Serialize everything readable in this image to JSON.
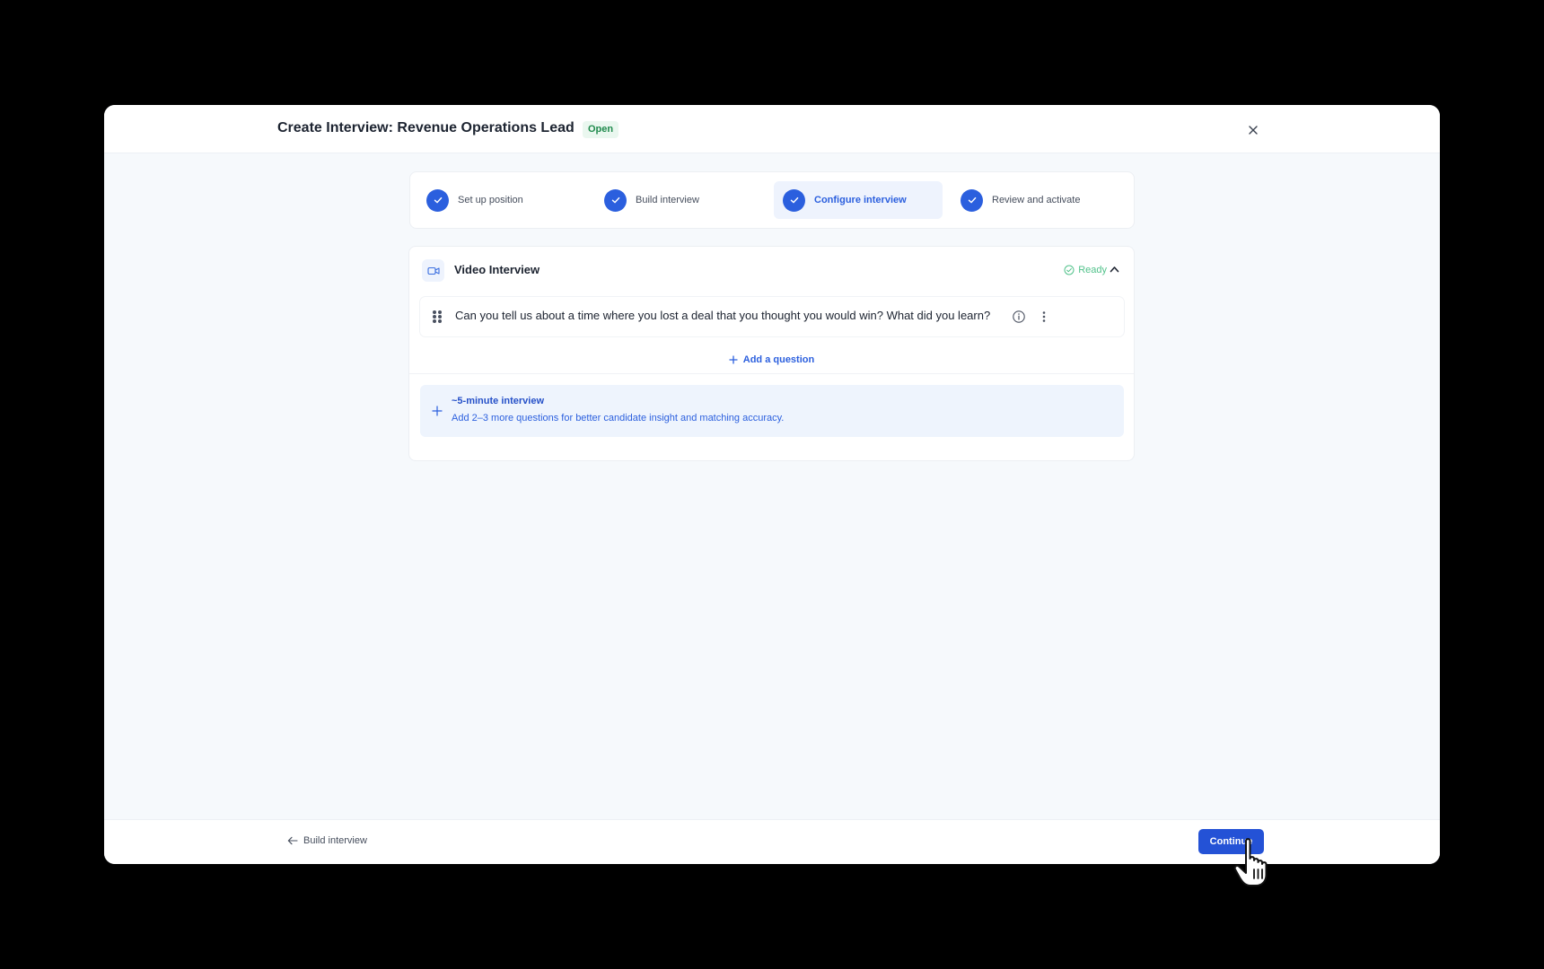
{
  "header": {
    "title": "Create Interview: Revenue Operations Lead",
    "status": "Open"
  },
  "steps": [
    {
      "label": "Set up position",
      "state": "complete"
    },
    {
      "label": "Build interview",
      "state": "complete"
    },
    {
      "label": "Configure interview",
      "state": "current"
    },
    {
      "label": "Review and activate",
      "state": "complete"
    }
  ],
  "section": {
    "title": "Video Interview",
    "status": "Ready",
    "icon": "video-camera-icon",
    "questions": [
      {
        "text": "Can you tell us about a time where you lost a deal that you thought you would win? What did you learn?"
      }
    ],
    "add_question_label": "Add a question",
    "tip": {
      "title": "~5-minute interview",
      "description": "Add 2–3 more questions for better candidate insight and matching accuracy."
    }
  },
  "footer": {
    "back_label": "Build interview",
    "continue_label": "Continue"
  },
  "colors": {
    "primary": "#2452d6",
    "ready": "#52c28b",
    "open_badge": "#1f8a4c"
  }
}
